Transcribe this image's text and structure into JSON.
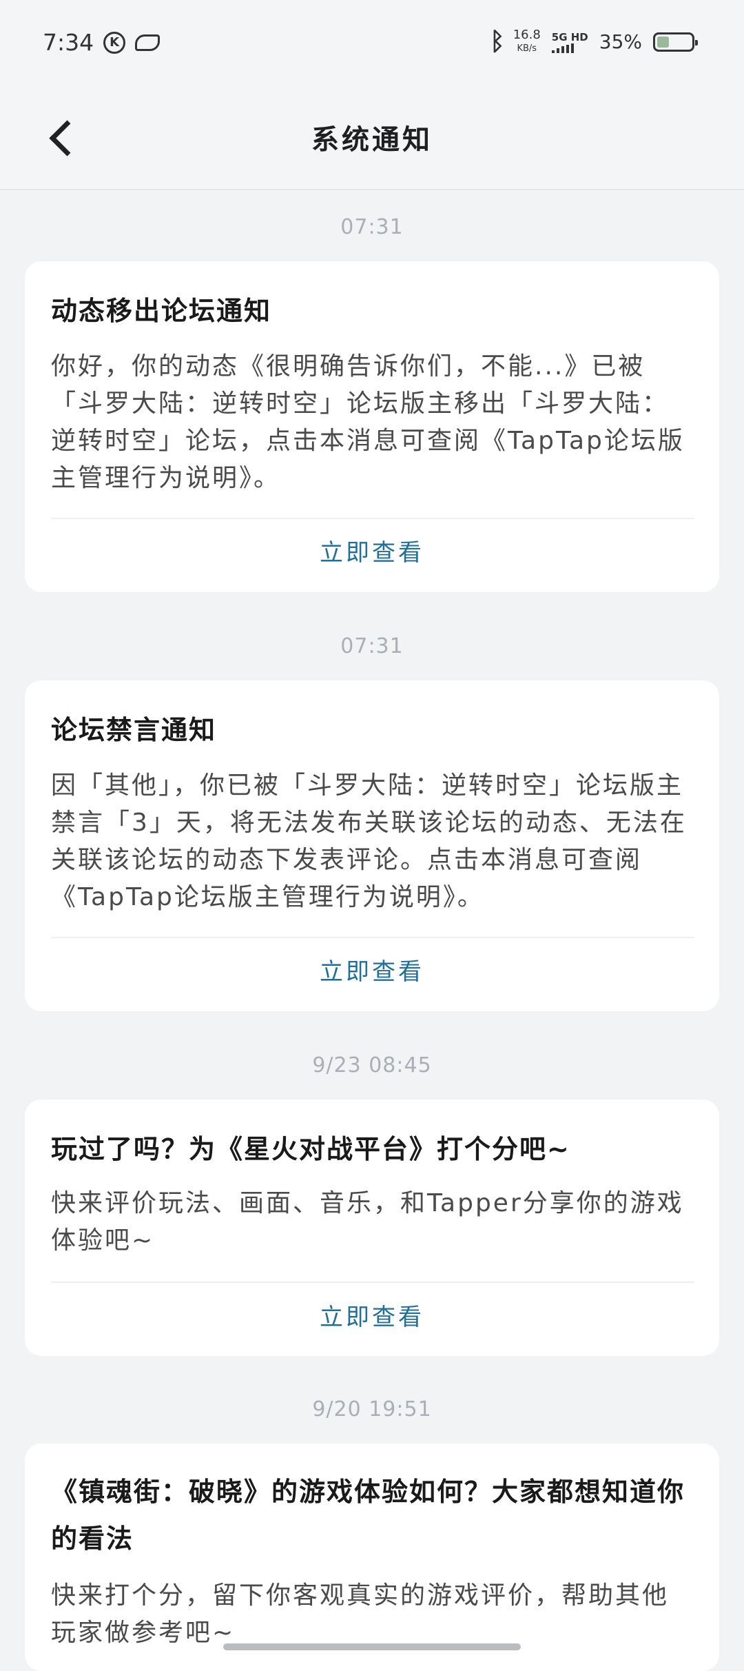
{
  "status_bar": {
    "time": "7:34",
    "k_icon_text": "K",
    "net_speed_value": "16.8",
    "net_speed_unit": "KB/s",
    "signal_label": "5G HD",
    "battery_percent": "35%",
    "battery_level": 0.35,
    "icons": [
      "k-icon",
      "leaf-icon",
      "bluetooth-icon",
      "signal-icon",
      "battery-icon"
    ]
  },
  "header": {
    "title": "系统通知",
    "back_icon": "chevron-left-icon"
  },
  "notifications": [
    {
      "time": "07:31",
      "title": "动态移出论坛通知",
      "body": "你好，你的动态《很明确告诉你们，不能...》已被「斗罗大陆：逆转时空」论坛版主移出「斗罗大陆：逆转时空」论坛，点击本消息可查阅《TapTap论坛版主管理行为说明》。",
      "action": "立即查看"
    },
    {
      "time": "07:31",
      "title": "论坛禁言通知",
      "body": "因「其他」，你已被「斗罗大陆：逆转时空」论坛版主禁言「3」天，将无法发布关联该论坛的动态、无法在关联该论坛的动态下发表评论。点击本消息可查阅《TapTap论坛版主管理行为说明》。",
      "action": "立即查看"
    },
    {
      "time": "9/23  08:45",
      "title": "玩过了吗？为《星火对战平台》打个分吧~",
      "body": "快来评价玩法、画面、音乐，和Tapper分享你的游戏体验吧~",
      "action": "立即查看"
    },
    {
      "time": "9/20  19:51",
      "title": "《镇魂街：破晓》的游戏体验如何？大家都想知道你的看法",
      "body": "快来打个分，留下你客观真实的游戏评价，帮助其他玩家做参考吧~",
      "action": ""
    }
  ],
  "colors": {
    "page_bg": "#f1f3f5",
    "card_bg": "#ffffff",
    "action_blue": "#1f6f9a",
    "time_gray": "#a9afb6"
  }
}
